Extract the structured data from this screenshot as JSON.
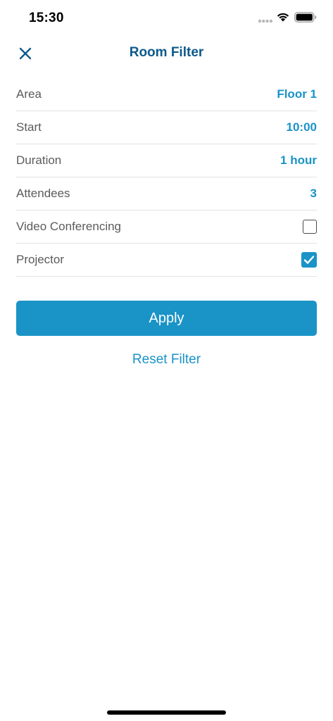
{
  "status_bar": {
    "time": "15:30",
    "icons": [
      "cellular-signal-icon",
      "wifi-icon",
      "battery-icon"
    ]
  },
  "nav": {
    "title": "Room Filter",
    "close_icon": "close-icon"
  },
  "filters": [
    {
      "label": "Area",
      "value": "Floor 1"
    },
    {
      "label": "Start",
      "value": "10:00"
    },
    {
      "label": "Duration",
      "value": "1 hour"
    },
    {
      "label": "Attendees",
      "value": "3"
    },
    {
      "label": "Video Conferencing",
      "checked": false
    },
    {
      "label": "Projector",
      "checked": true
    }
  ],
  "actions": {
    "apply_label": "Apply",
    "reset_label": "Reset Filter"
  },
  "colors": {
    "accent": "#1a93c7",
    "title": "#0d5a8c",
    "label": "#5b5b5b",
    "divider": "#e2e2e2"
  }
}
